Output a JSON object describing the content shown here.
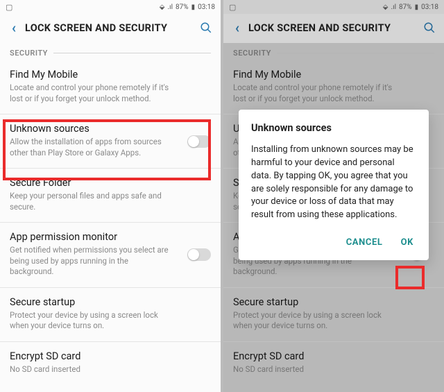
{
  "status": {
    "left_icon": "▢",
    "battery_saver_icon": "⚡",
    "signal_icon": "📶",
    "battery_pct": "87%",
    "battery_icon": "▮",
    "time": "03:18"
  },
  "header": {
    "back_glyph": "‹",
    "title": "LOCK SCREEN AND SECURITY"
  },
  "section": {
    "label": "SECURITY"
  },
  "items": {
    "find": {
      "label": "Find My Mobile",
      "desc": "Locate and control your phone remotely if it's lost or if you forget your unlock method."
    },
    "unknown": {
      "label": "Unknown sources",
      "desc": "Allow the installation of apps from sources other than Play Store or Galaxy Apps."
    },
    "securefolder": {
      "label": "Secure Folder",
      "desc": "Keep your personal files and apps safe and secure."
    },
    "apm": {
      "label": "App permission monitor",
      "desc": "Get notified when permissions you select are being used by apps running in the background."
    },
    "securestartup": {
      "label": "Secure startup",
      "desc": "Protect your device by using a screen lock when your device turns on."
    },
    "encrypt": {
      "label": "Encrypt SD card",
      "desc": "No SD card inserted"
    }
  },
  "dialog": {
    "title": "Unknown sources",
    "body": "Installing from unknown sources may be harmful to your device and personal data. By tapping OK, you agree that you are solely responsible for any damage to your device or loss of data that may result from using these applications.",
    "cancel": "CANCEL",
    "ok": "OK"
  }
}
